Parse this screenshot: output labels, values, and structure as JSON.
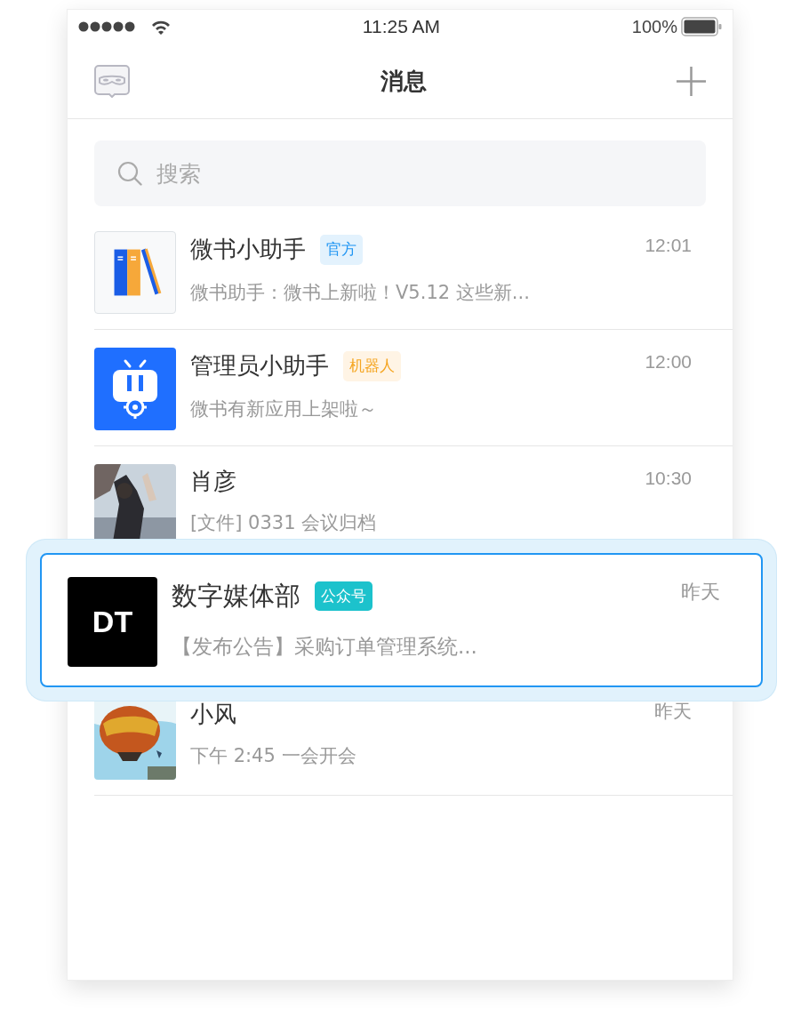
{
  "status_bar": {
    "time": "11:25 AM",
    "battery": "100%"
  },
  "nav": {
    "title": "消息"
  },
  "search": {
    "placeholder": "搜索"
  },
  "conversations": [
    {
      "name": "微书小助手",
      "avatar": {
        "kind": "books"
      },
      "badge": {
        "text": "官方",
        "color": "#e3f2fd"
      },
      "preview": "微书助手：微书上新啦！V5.12 这些新...",
      "time": "12:01",
      "lifted": false
    },
    {
      "name": "管理员小助手",
      "avatar": {
        "kind": "robot"
      },
      "badge": {
        "text": "机器人",
        "color": "#fff4e5"
      },
      "preview": "微书有新应用上架啦～",
      "time": "12:00",
      "lifted": false
    },
    {
      "name": "肖彦",
      "preview": "[文件] 0331 会议归档",
      "time": "10:30",
      "lifted": false
    },
    {
      "name": "数字媒体部",
      "avatar": {
        "kind": "logo",
        "text": "DT"
      },
      "badge": {
        "text": "公众号",
        "color": "#1cc2cc"
      },
      "preview": "【发布公告】采购订单管理系统...",
      "time": "昨天",
      "lifted": true
    },
    {
      "name": "小风",
      "preview": "下午 2:45 一会开会",
      "time": "昨天",
      "lifted": false
    }
  ]
}
